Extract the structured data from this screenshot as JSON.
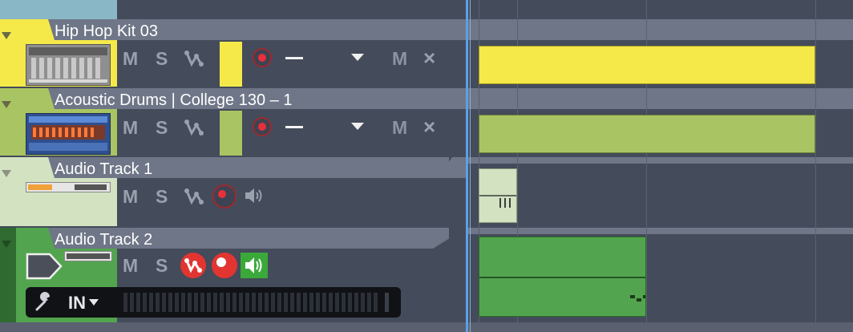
{
  "tracks": [
    {
      "name": "Hip Hop Kit 03",
      "color": "#f5e94a",
      "mute": "M",
      "solo": "S",
      "mute_right": "M"
    },
    {
      "name": "Acoustic Drums | College  130 – 1",
      "color": "#a9c462",
      "mute": "M",
      "solo": "S",
      "mute_right": "M"
    },
    {
      "name": "Audio Track 1",
      "color": "#d3e2c1",
      "mute": "M",
      "solo": "S"
    },
    {
      "name": "Audio Track 2",
      "color": "#52a54e",
      "mute": "M",
      "solo": "S",
      "input_label": "IN"
    }
  ],
  "colors": {
    "background": "#444b5a",
    "name_bar": "#6f7687",
    "playhead": "#5aa0e8",
    "record": "#e23531",
    "monitor": "#3aa93a"
  },
  "icons": [
    "triangle-collapse-icon",
    "instrument-thumbnail-icon",
    "automation-icon",
    "record-icon",
    "speaker-icon",
    "close-icon",
    "wrench-icon",
    "input-arrow-icon"
  ]
}
